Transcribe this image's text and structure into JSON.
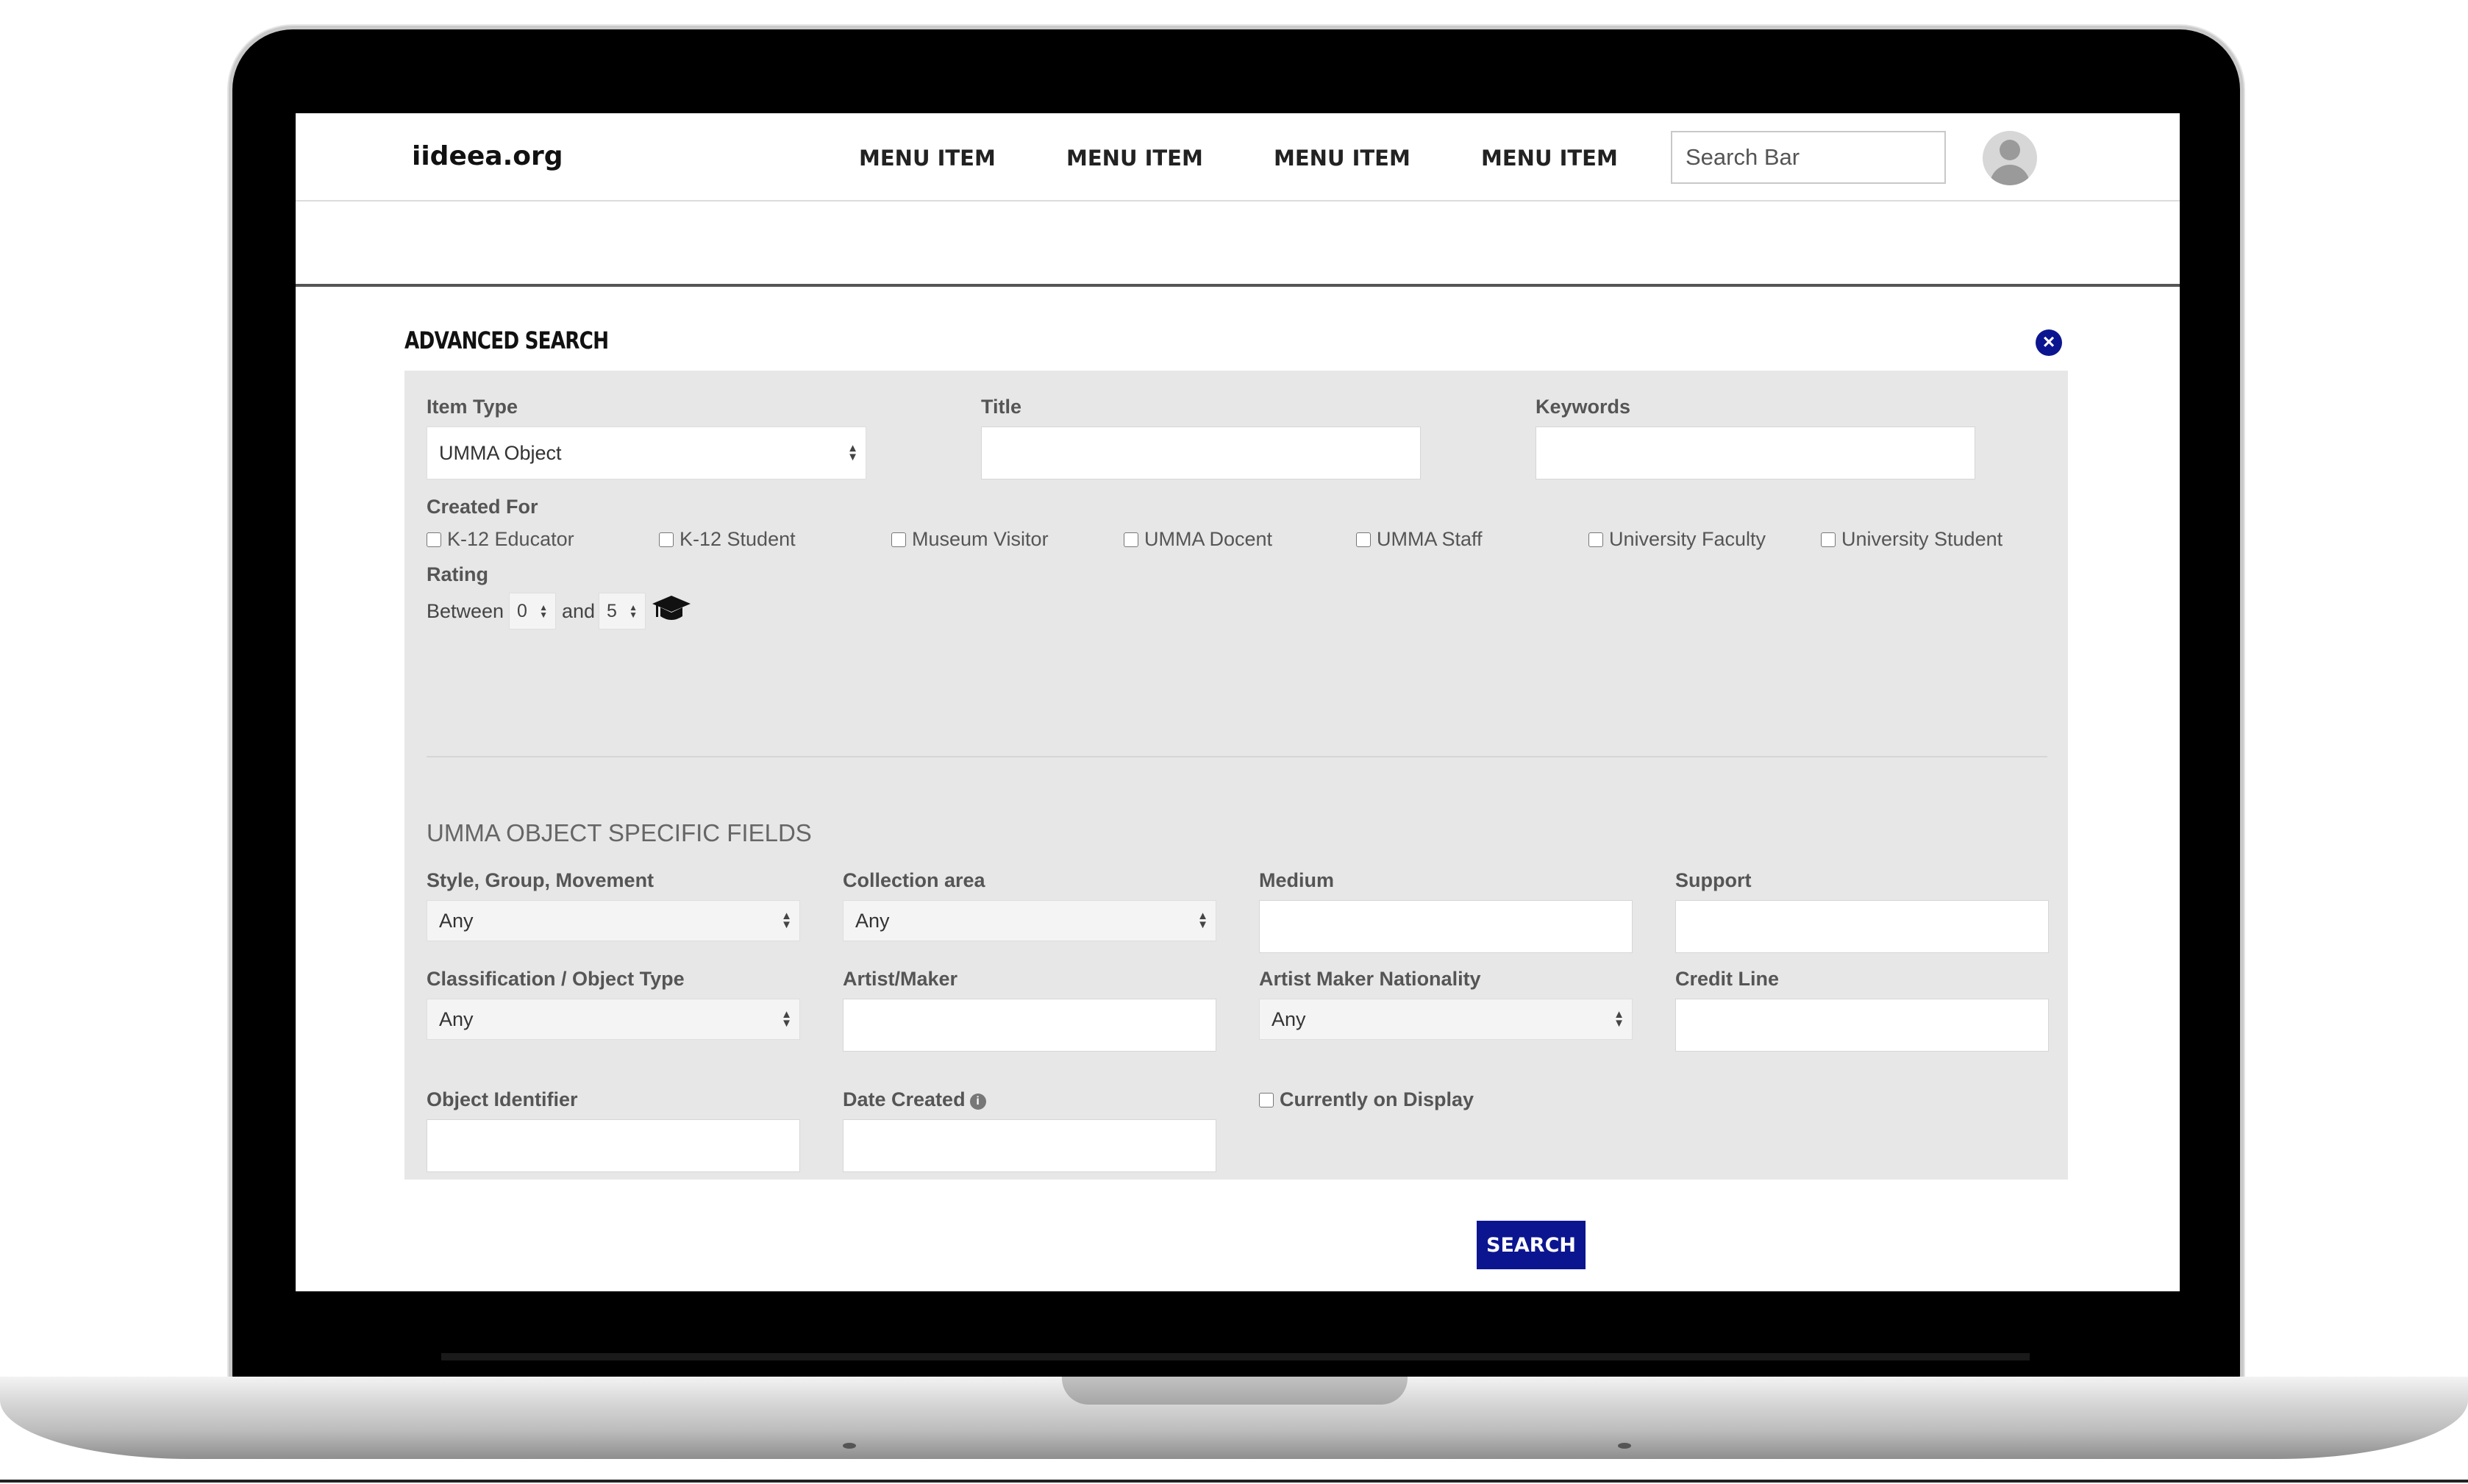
{
  "nav": {
    "brand": "iideea.org",
    "menu_items": [
      "MENU ITEM",
      "MENU ITEM",
      "MENU ITEM",
      "MENU ITEM"
    ],
    "search_placeholder": "Search Bar"
  },
  "panel": {
    "title": "ADVANCED SEARCH",
    "item_type": {
      "label": "Item Type",
      "value": "UMMA Object"
    },
    "title_field": {
      "label": "Title"
    },
    "keywords": {
      "label": "Keywords"
    },
    "created_for": {
      "label": "Created For",
      "options": [
        "K-12 Educator",
        "K-12 Student",
        "Museum Visitor",
        "UMMA Docent",
        "UMMA Staff",
        "University Faculty",
        "University Student"
      ]
    },
    "rating": {
      "label": "Rating",
      "between": "Between",
      "and": "and",
      "min": "0",
      "max": "5"
    },
    "section_heading": "UMMA OBJECT SPECIFIC FIELDS",
    "style_group": {
      "label": "Style, Group, Movement",
      "value": "Any"
    },
    "collection_area": {
      "label": "Collection area",
      "value": "Any"
    },
    "medium": {
      "label": "Medium"
    },
    "support": {
      "label": "Support"
    },
    "classification": {
      "label": "Classification / Object Type",
      "value": "Any"
    },
    "artist_maker": {
      "label": "Artist/Maker"
    },
    "artist_nationality": {
      "label": "Artist Maker Nationality",
      "value": "Any"
    },
    "credit_line": {
      "label": "Credit Line"
    },
    "object_identifier": {
      "label": "Object Identifier"
    },
    "date_created": {
      "label": "Date Created"
    },
    "currently_on_display": {
      "label": "Currently on Display"
    },
    "search_button": "SEARCH"
  },
  "colors": {
    "accent": "#0c1590",
    "panel_bg": "#e7e7e7"
  }
}
